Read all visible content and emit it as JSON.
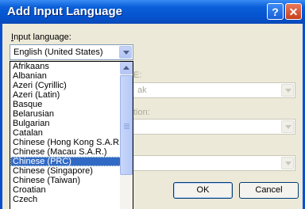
{
  "window": {
    "title": "Add Input Language",
    "help_glyph": "?",
    "close_glyph": "✕"
  },
  "input_language": {
    "label_accel": "I",
    "label_rest": "nput language:",
    "selected_value": "English (United States)"
  },
  "dropdown": {
    "items": [
      "Afrikaans",
      "Albanian",
      "Azeri (Cyrillic)",
      "Azeri (Latin)",
      "Basque",
      "Belarusian",
      "Bulgarian",
      "Catalan",
      "Chinese (Hong Kong S.A.R.)",
      "Chinese (Macau S.A.R.)",
      "Chinese (PRC)",
      "Chinese (Singapore)",
      "Chinese (Taiwan)",
      "Croatian",
      "Czech"
    ],
    "selected_index": 10
  },
  "obscured": {
    "label1_tail": "E:",
    "field1_tail": "ak",
    "label2_tail": "tion:"
  },
  "buttons": {
    "ok": "OK",
    "cancel": "Cancel"
  },
  "colors": {
    "title_bar": "#0553cf",
    "selection": "#316ac5",
    "dialog_bg": "#ece9d8"
  }
}
